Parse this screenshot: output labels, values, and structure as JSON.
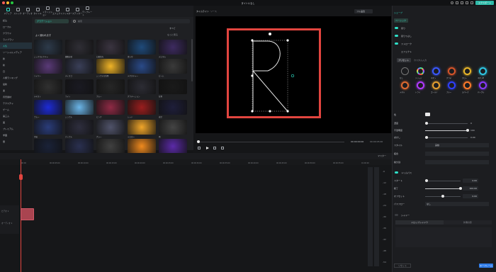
{
  "window": {
    "title": "タイトルなし"
  },
  "toolbar": {
    "items": [
      "メディア",
      "ストック",
      "オーディオ",
      "タイトル",
      "トランジション",
      "エフェクト",
      "フィルター",
      "ステッカー",
      "テンプレート"
    ]
  },
  "leftnav": {
    "items": [
      "読込",
      "ローカル",
      "クラウド",
      "ライブラリ",
      "人気",
      "ソーシャルメディア",
      "新",
      "新",
      "日",
      "人類ランキング",
      "最新",
      "楽",
      "背景素材",
      "テクスチャ",
      "ゲーム",
      "第三ム",
      "美",
      "プレミアム",
      "学園",
      "闇",
      "最新ソーシャル",
      "ケーター"
    ]
  },
  "media": {
    "tag_active": "グラデーション",
    "search_placeholder": "検索",
    "section_title": "よく使われます",
    "section_more": "もっと見る",
    "subbar_title": "すべて",
    "cards": [
      {
        "label": "シックなピクチャ",
        "color": "#2d3a4a"
      },
      {
        "label": "細胞分裂",
        "color": "#2f2e35"
      },
      {
        "label": "幻想的光",
        "color": "#3a3440"
      },
      {
        "label": "青い空",
        "color": "#1f4a7a"
      },
      {
        "label": "デジタル",
        "color": "#3d2b60"
      },
      {
        "label": "ハイパー",
        "color": "#5a3a78"
      },
      {
        "label": "ディスコ",
        "color": "#3a3f58"
      },
      {
        "label": "シンプルな背景",
        "color": "#f0b427"
      },
      {
        "label": "テクスチャー",
        "color": "#2a4a88"
      },
      {
        "label": "ビーム",
        "color": "#3a3a3a"
      },
      {
        "label": "テキスト",
        "color": "#303030"
      },
      {
        "label": "ライト",
        "color": "#1a1a22"
      },
      {
        "label": "ブルー",
        "color": "#262626"
      },
      {
        "label": "グラデーション",
        "color": "#2c2c34"
      },
      {
        "label": "背景",
        "color": "#1a1a1a"
      },
      {
        "label": "ブルー",
        "color": "#1d2bd6"
      },
      {
        "label": "シンプル",
        "color": "#6bb5e8"
      },
      {
        "label": "ピンク",
        "color": "#8f2a45"
      },
      {
        "label": "レッド",
        "color": "#9a1e1e"
      },
      {
        "label": "夜空",
        "color": "#1e1e3a"
      },
      {
        "label": "宇宙",
        "color": "#2a3c7a"
      },
      {
        "label": "パープル",
        "color": "#2e2e3e"
      },
      {
        "label": "グレー",
        "color": "#50536a"
      },
      {
        "label": "イエロー",
        "color": "#f1a62a"
      },
      {
        "label": "雨",
        "color": "#444"
      },
      {
        "label": "星空",
        "color": "#1a2238"
      },
      {
        "label": "ライト",
        "color": "#2a3050"
      },
      {
        "label": "モノクロ",
        "color": "#404040"
      },
      {
        "label": "オレンジ",
        "color": "#f08a1e"
      },
      {
        "label": "ネオン",
        "color": "#5b2aa8"
      }
    ]
  },
  "preview": {
    "tabs": [
      "タイムライン",
      "ソース"
    ],
    "quality": "フル品質",
    "time_current": "00:00:00:00",
    "time_total": "00:00:05:00"
  },
  "timeline": {
    "ticks": [
      "00:00",
      "00:00:05:00",
      "00:00:10:00",
      "00:00:15:00",
      "00:00:20:00",
      "00:00:25:00",
      "00:00:30:00",
      "00:00:35:00",
      "00:00:40:00",
      "00:00:45:00",
      "00:00:50:00",
      "00:00:55:00",
      "01:00:00"
    ],
    "meter_labels": [
      "-6",
      "-12",
      "-18",
      "-24",
      "-30",
      "-36",
      "-42",
      "-48",
      "-54"
    ],
    "tracks": [
      "ビデオ 1",
      "オーディオ 1"
    ],
    "master_label": "マスター"
  },
  "props": {
    "export_button": "エクスポート",
    "tab": "シェープ",
    "section_basic": "ベーシック",
    "toggle_fill": "塗り",
    "toggle_mask": "塗りつぶし",
    "toggle_stroke": "ストローク",
    "effect_label": "エフェクト",
    "preset_tab": "プリセット",
    "custom_tab": "カスタム入力",
    "presets": [
      {
        "name": "なし",
        "c": "#555"
      },
      {
        "name": "ソリッド",
        "c": "conic"
      },
      {
        "name": "ネオン",
        "c": "#3a58ff"
      },
      {
        "name": "グラデ",
        "c": "#d7552a"
      },
      {
        "name": "グロー",
        "c": "#e8b62a"
      },
      {
        "name": "ネオンB",
        "c": "#2ec8e6"
      },
      {
        "name": "メタル",
        "c": "#e06a30"
      },
      {
        "name": "トライ",
        "c": "#b23aff"
      },
      {
        "name": "ゴールド",
        "c": "#e6a030"
      },
      {
        "name": "ブルー",
        "c": "#3040ff"
      },
      {
        "name": "スパーク",
        "c": "#ff7a2a"
      },
      {
        "name": "パープル",
        "c": "#8a3aff"
      }
    ],
    "color_label": "色",
    "opacity_label": "濃度",
    "opacity_value": "0",
    "blur_label": "不透明度",
    "blur_value": "100",
    "width_label": "ぼかし",
    "width_value": "0.00",
    "style_label": "スタイル",
    "style_value": "実線",
    "join_label": "結合",
    "cap_label": "線分割",
    "section_trim": "トリムパス",
    "start_label": "スタート",
    "start_value": "0.00",
    "end_label": "終了",
    "end_value": "100.00",
    "offset_label": "オフセット",
    "offset_value": "0.00",
    "path_label": "パスフロー",
    "path_value": "なし",
    "section_shadow": "シャドー",
    "shadow_tabs": [
      "ドロップシャドウ",
      "外側の影"
    ],
    "reset_label": "リセット",
    "keyframe_label": "キーフレーム"
  }
}
